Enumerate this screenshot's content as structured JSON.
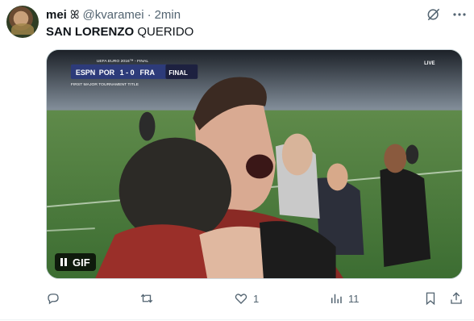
{
  "author": {
    "name": "mei",
    "name_emoji": "ꕤ",
    "handle": "@kvaramei",
    "separator": "·",
    "time": "2min"
  },
  "tweet": {
    "text_bold": "SAN LORENZO",
    "text_rest": " QUERIDO"
  },
  "media": {
    "type": "gif",
    "badge_label": "GIF",
    "scoreboard": {
      "header": "UEFA EURO 2016™ - FINAL",
      "home": "POR",
      "score": "1 - 0",
      "away": "FRA",
      "stage": "FINAL",
      "caption": "FIRST MAJOR TOURNAMENT TITLE"
    },
    "broadcaster": "ESPN",
    "live_label": "LIVE"
  },
  "actions": {
    "replies": "",
    "retweets": "",
    "likes": "1",
    "views": "11"
  },
  "icons": [
    "grok-icon",
    "more-icon",
    "reply-icon",
    "retweet-icon",
    "like-icon",
    "views-icon",
    "bookmark-icon",
    "share-icon",
    "pause-icon"
  ],
  "colors": {
    "text": "#0f1419",
    "secondary": "#536471",
    "border": "#cfd9de"
  }
}
